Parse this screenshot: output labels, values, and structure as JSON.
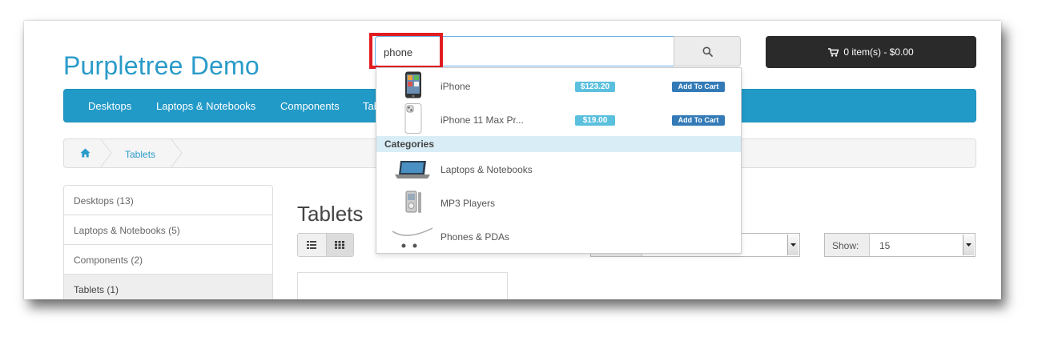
{
  "store": {
    "name": "Purpletree Demo"
  },
  "search": {
    "value": "phone",
    "placeholder": ""
  },
  "cart": {
    "label": "0 item(s) - $0.00"
  },
  "menu": {
    "items": [
      {
        "label": "Desktops"
      },
      {
        "label": "Laptops & Notebooks"
      },
      {
        "label": "Components"
      },
      {
        "label": "Tab"
      }
    ]
  },
  "breadcrumb": {
    "home_icon": "home-icon",
    "items": [
      {
        "label": "Tablets"
      }
    ]
  },
  "sidebar": {
    "items": [
      {
        "label": "Desktops (13)"
      },
      {
        "label": "Laptops & Notebooks (5)"
      },
      {
        "label": "Components (2)"
      },
      {
        "label": "Tablets (1)"
      }
    ]
  },
  "main": {
    "title": "Tablets",
    "show_label": "Show:",
    "show_value": "15"
  },
  "autocomplete": {
    "products": [
      {
        "name": "iPhone",
        "price": "$123.20",
        "add_label": "Add To Cart"
      },
      {
        "name": "iPhone 11 Max Pr...",
        "price": "$19.00",
        "add_label": "Add To Cart"
      }
    ],
    "categories_header": "Categories",
    "categories": [
      {
        "name": "Laptops & Notebooks"
      },
      {
        "name": "MP3 Players"
      },
      {
        "name": "Phones & PDAs"
      }
    ]
  },
  "colors": {
    "accent": "#229ac8",
    "highlight_border": "#e11d22",
    "price_badge": "#5bc0de",
    "add_button": "#337ab7",
    "cart_button": "#2a2a2a"
  }
}
